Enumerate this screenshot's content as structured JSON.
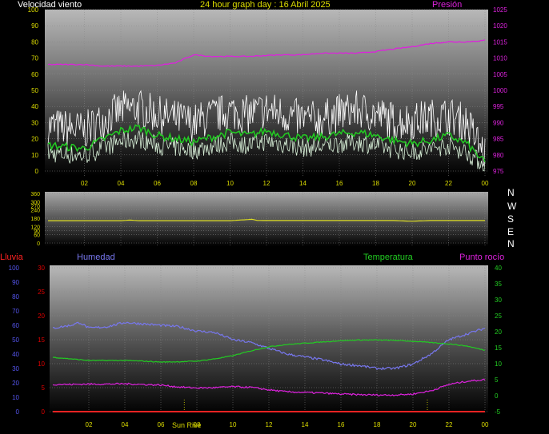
{
  "header": {
    "title": "24 hour graph day : 16 Abril 2025",
    "wind_label": "Velocidad viento",
    "pressure_label": "Presión"
  },
  "lower_header": {
    "rain_label": "Lluvia",
    "humidity_label": "Humedad",
    "temperature_label": "Temperatura",
    "dewpoint_label": "Punto rocío"
  },
  "sunrise_label": "Sun Rise",
  "compass": [
    "N",
    "W",
    "S",
    "E",
    "N"
  ],
  "colors": {
    "wind_gust": "#ffffff",
    "wind_avg": "#d8f0d8",
    "wind_avg_smooth": "#22cc22",
    "pressure": "#dd22dd",
    "direction": "#dddd22",
    "humidity": "#7777ee",
    "temperature": "#22cc22",
    "dewpoint": "#dd22dd",
    "rain": "#ff2222",
    "axis_yellow": "#dddd00",
    "rain_axis": "#dd0000",
    "humidity_axis": "#5555ee",
    "temp_axis": "#22cc22"
  },
  "chart_data": [
    {
      "type": "line",
      "name": "wind-pressure",
      "x": [
        "02",
        "04",
        "06",
        "08",
        "10",
        "12",
        "14",
        "16",
        "18",
        "20",
        "22",
        "00"
      ],
      "ylim_left": [
        0,
        100
      ],
      "yticks_left": [
        0,
        10,
        20,
        30,
        40,
        50,
        60,
        70,
        80,
        90,
        100
      ],
      "ylim_right": [
        975,
        1025
      ],
      "yticks_right": [
        975,
        980,
        985,
        990,
        995,
        1000,
        1005,
        1010,
        1015,
        1020,
        1025
      ],
      "series": [
        {
          "name": "Velocidad viento",
          "x": [
            0,
            2,
            4,
            5,
            6,
            8,
            9,
            10,
            11,
            12,
            14,
            15,
            16,
            17,
            18,
            19,
            20,
            21,
            22,
            23,
            24
          ],
          "gust": [
            28,
            25,
            38,
            39,
            35,
            30,
            34,
            37,
            35,
            38,
            32,
            32,
            36,
            38,
            35,
            31,
            31,
            33,
            34,
            30,
            10
          ],
          "avg": [
            16,
            14,
            25,
            27,
            22,
            18,
            21,
            24,
            22,
            25,
            20,
            21,
            23,
            24,
            22,
            19,
            17,
            19,
            22,
            17,
            5
          ],
          "low": [
            6,
            5,
            12,
            13,
            10,
            8,
            10,
            12,
            10,
            12,
            9,
            9,
            11,
            12,
            10,
            8,
            7,
            8,
            10,
            6,
            2
          ]
        },
        {
          "name": "Presión",
          "x": [
            0,
            1,
            2,
            3,
            4,
            5,
            6,
            7,
            8,
            9,
            10,
            11,
            12,
            13,
            14,
            15,
            16,
            17,
            18,
            19,
            20,
            21,
            22,
            23,
            24
          ],
          "y": [
            1008,
            1008,
            1008,
            1007.5,
            1007.5,
            1007.5,
            1007.7,
            1008.5,
            1011,
            1010.5,
            1010.5,
            1010.5,
            1010.8,
            1011,
            1011,
            1011.5,
            1011.5,
            1011.5,
            1012,
            1012.8,
            1013.5,
            1014.5,
            1015,
            1015,
            1015.5
          ]
        }
      ]
    },
    {
      "type": "line",
      "name": "wind-direction",
      "x": [
        "02",
        "04",
        "06",
        "08",
        "10",
        "12",
        "14",
        "16",
        "18",
        "20",
        "22",
        "00"
      ],
      "ylim": [
        0,
        360
      ],
      "yticks": [
        0,
        60,
        90,
        120,
        180,
        240,
        270,
        300,
        360
      ],
      "series": [
        {
          "x": [
            0,
            4,
            4.5,
            5,
            10,
            11.2,
            11.5,
            12,
            19,
            19.5,
            20,
            21,
            24
          ],
          "y": [
            162,
            162,
            166,
            162,
            162,
            172,
            164,
            163,
            163,
            160,
            158,
            163,
            163
          ]
        }
      ]
    },
    {
      "type": "line",
      "name": "temp-humidity",
      "x": [
        "02",
        "04",
        "06",
        "08",
        "10",
        "12",
        "14",
        "16",
        "18",
        "20",
        "22",
        "00"
      ],
      "ylim_left": [
        0,
        100
      ],
      "yticks_left": [
        0,
        10,
        20,
        30,
        40,
        50,
        60,
        70,
        80,
        90,
        100
      ],
      "ylim_rain": [
        0,
        30
      ],
      "yticks_rain": [
        0,
        5,
        10,
        15,
        20,
        25,
        30
      ],
      "ylim_right": [
        -5,
        40
      ],
      "yticks_right": [
        -5,
        0,
        5,
        10,
        15,
        20,
        25,
        30,
        35,
        40
      ],
      "series": [
        {
          "name": "Humedad",
          "x": [
            0,
            1,
            1.5,
            2,
            3,
            4,
            5,
            6,
            7,
            8,
            9,
            10,
            11,
            12,
            13,
            14,
            15,
            16,
            17,
            18,
            19,
            20,
            21,
            22,
            23,
            24
          ],
          "y": [
            58,
            60,
            62,
            58,
            59,
            62,
            61,
            60,
            59,
            56,
            55,
            50,
            48,
            44,
            40,
            38,
            36,
            33,
            32,
            30,
            30,
            33,
            40,
            50,
            54,
            58
          ]
        },
        {
          "name": "Temperatura",
          "x": [
            0,
            1,
            2,
            3,
            4,
            5,
            6,
            7,
            8,
            9,
            10,
            11,
            12,
            13,
            14,
            15,
            16,
            17,
            18,
            19,
            20,
            21,
            22,
            23,
            24
          ],
          "y": [
            12,
            11.5,
            11,
            11,
            11,
            10.8,
            10.5,
            10.6,
            10.8,
            11.5,
            12.5,
            14,
            15.3,
            16,
            16.4,
            16.8,
            17.2,
            17.4,
            17.4,
            17.3,
            17,
            16.6,
            16.2,
            15.5,
            14.2
          ]
        },
        {
          "name": "Punto rocío",
          "x": [
            0,
            1,
            2,
            3,
            4,
            5,
            6,
            7,
            8,
            9,
            10,
            11,
            12,
            13,
            14,
            15,
            16,
            17,
            18,
            19,
            20,
            21,
            22,
            23,
            24
          ],
          "y": [
            3.5,
            3.5,
            3.6,
            3.6,
            3.7,
            3.5,
            3.3,
            2.7,
            2.4,
            2.5,
            2.8,
            2.6,
            1.8,
            1.2,
            1,
            0.8,
            0.5,
            0.3,
            0.2,
            0.2,
            0.5,
            1.5,
            3.5,
            4.5,
            5
          ]
        },
        {
          "name": "Lluvia",
          "x": [
            0,
            24
          ],
          "y": [
            0,
            0
          ]
        }
      ]
    }
  ]
}
